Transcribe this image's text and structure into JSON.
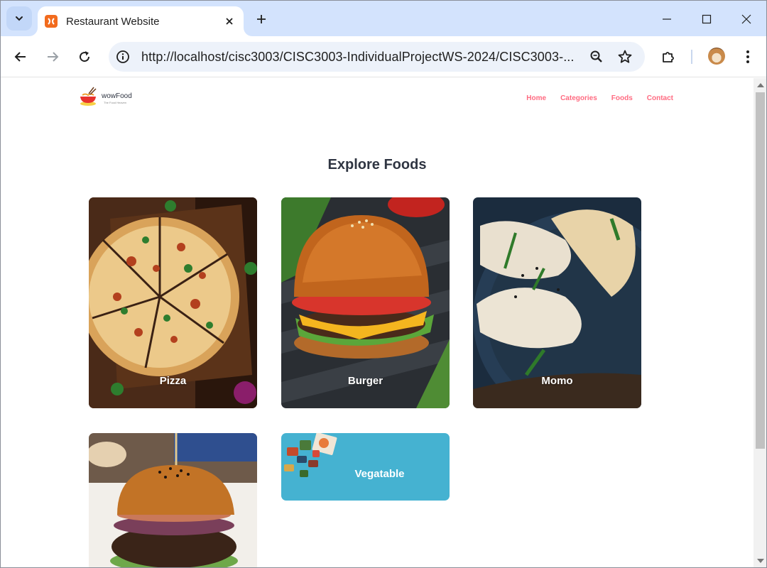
{
  "browser": {
    "tab_title": "Restaurant Website",
    "url": "http://localhost/cisc3003/CISC3003-IndividualProjectWS-2024/CISC3003-..."
  },
  "site": {
    "logo_text": "wowFood",
    "logo_tagline": "The Food Heaven",
    "menu": [
      {
        "label": "Home"
      },
      {
        "label": "Categories"
      },
      {
        "label": "Foods"
      },
      {
        "label": "Contact"
      }
    ],
    "heading": "Explore Foods",
    "categories": [
      {
        "label": "Pizza"
      },
      {
        "label": "Burger"
      },
      {
        "label": "Momo"
      },
      {
        "label": ""
      },
      {
        "label": "Vegatable"
      }
    ]
  },
  "colors": {
    "menu_link": "#ff6b81",
    "heading": "#2f3542",
    "tabstrip": "#d3e3fd",
    "vegetable_card": "#45b2d1"
  }
}
